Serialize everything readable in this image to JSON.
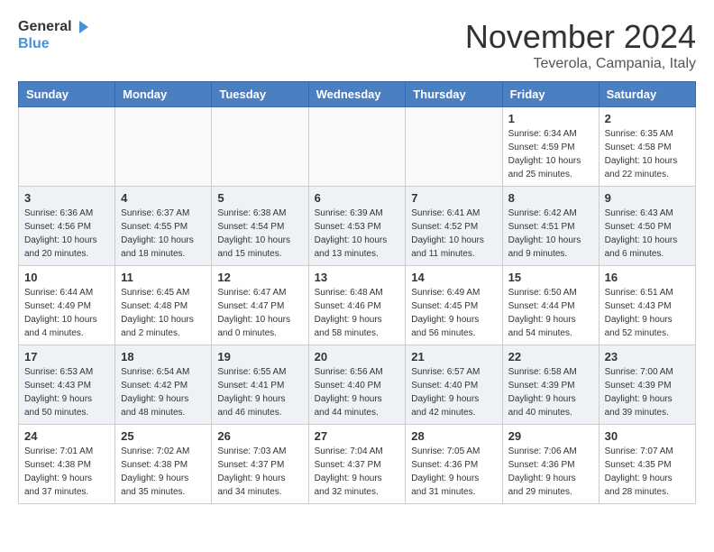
{
  "header": {
    "logo_line1": "General",
    "logo_line2": "Blue",
    "month": "November 2024",
    "location": "Teverola, Campania, Italy"
  },
  "weekdays": [
    "Sunday",
    "Monday",
    "Tuesday",
    "Wednesday",
    "Thursday",
    "Friday",
    "Saturday"
  ],
  "weeks": [
    [
      {
        "day": "",
        "info": ""
      },
      {
        "day": "",
        "info": ""
      },
      {
        "day": "",
        "info": ""
      },
      {
        "day": "",
        "info": ""
      },
      {
        "day": "",
        "info": ""
      },
      {
        "day": "1",
        "info": "Sunrise: 6:34 AM\nSunset: 4:59 PM\nDaylight: 10 hours\nand 25 minutes."
      },
      {
        "day": "2",
        "info": "Sunrise: 6:35 AM\nSunset: 4:58 PM\nDaylight: 10 hours\nand 22 minutes."
      }
    ],
    [
      {
        "day": "3",
        "info": "Sunrise: 6:36 AM\nSunset: 4:56 PM\nDaylight: 10 hours\nand 20 minutes."
      },
      {
        "day": "4",
        "info": "Sunrise: 6:37 AM\nSunset: 4:55 PM\nDaylight: 10 hours\nand 18 minutes."
      },
      {
        "day": "5",
        "info": "Sunrise: 6:38 AM\nSunset: 4:54 PM\nDaylight: 10 hours\nand 15 minutes."
      },
      {
        "day": "6",
        "info": "Sunrise: 6:39 AM\nSunset: 4:53 PM\nDaylight: 10 hours\nand 13 minutes."
      },
      {
        "day": "7",
        "info": "Sunrise: 6:41 AM\nSunset: 4:52 PM\nDaylight: 10 hours\nand 11 minutes."
      },
      {
        "day": "8",
        "info": "Sunrise: 6:42 AM\nSunset: 4:51 PM\nDaylight: 10 hours\nand 9 minutes."
      },
      {
        "day": "9",
        "info": "Sunrise: 6:43 AM\nSunset: 4:50 PM\nDaylight: 10 hours\nand 6 minutes."
      }
    ],
    [
      {
        "day": "10",
        "info": "Sunrise: 6:44 AM\nSunset: 4:49 PM\nDaylight: 10 hours\nand 4 minutes."
      },
      {
        "day": "11",
        "info": "Sunrise: 6:45 AM\nSunset: 4:48 PM\nDaylight: 10 hours\nand 2 minutes."
      },
      {
        "day": "12",
        "info": "Sunrise: 6:47 AM\nSunset: 4:47 PM\nDaylight: 10 hours\nand 0 minutes."
      },
      {
        "day": "13",
        "info": "Sunrise: 6:48 AM\nSunset: 4:46 PM\nDaylight: 9 hours\nand 58 minutes."
      },
      {
        "day": "14",
        "info": "Sunrise: 6:49 AM\nSunset: 4:45 PM\nDaylight: 9 hours\nand 56 minutes."
      },
      {
        "day": "15",
        "info": "Sunrise: 6:50 AM\nSunset: 4:44 PM\nDaylight: 9 hours\nand 54 minutes."
      },
      {
        "day": "16",
        "info": "Sunrise: 6:51 AM\nSunset: 4:43 PM\nDaylight: 9 hours\nand 52 minutes."
      }
    ],
    [
      {
        "day": "17",
        "info": "Sunrise: 6:53 AM\nSunset: 4:43 PM\nDaylight: 9 hours\nand 50 minutes."
      },
      {
        "day": "18",
        "info": "Sunrise: 6:54 AM\nSunset: 4:42 PM\nDaylight: 9 hours\nand 48 minutes."
      },
      {
        "day": "19",
        "info": "Sunrise: 6:55 AM\nSunset: 4:41 PM\nDaylight: 9 hours\nand 46 minutes."
      },
      {
        "day": "20",
        "info": "Sunrise: 6:56 AM\nSunset: 4:40 PM\nDaylight: 9 hours\nand 44 minutes."
      },
      {
        "day": "21",
        "info": "Sunrise: 6:57 AM\nSunset: 4:40 PM\nDaylight: 9 hours\nand 42 minutes."
      },
      {
        "day": "22",
        "info": "Sunrise: 6:58 AM\nSunset: 4:39 PM\nDaylight: 9 hours\nand 40 minutes."
      },
      {
        "day": "23",
        "info": "Sunrise: 7:00 AM\nSunset: 4:39 PM\nDaylight: 9 hours\nand 39 minutes."
      }
    ],
    [
      {
        "day": "24",
        "info": "Sunrise: 7:01 AM\nSunset: 4:38 PM\nDaylight: 9 hours\nand 37 minutes."
      },
      {
        "day": "25",
        "info": "Sunrise: 7:02 AM\nSunset: 4:38 PM\nDaylight: 9 hours\nand 35 minutes."
      },
      {
        "day": "26",
        "info": "Sunrise: 7:03 AM\nSunset: 4:37 PM\nDaylight: 9 hours\nand 34 minutes."
      },
      {
        "day": "27",
        "info": "Sunrise: 7:04 AM\nSunset: 4:37 PM\nDaylight: 9 hours\nand 32 minutes."
      },
      {
        "day": "28",
        "info": "Sunrise: 7:05 AM\nSunset: 4:36 PM\nDaylight: 9 hours\nand 31 minutes."
      },
      {
        "day": "29",
        "info": "Sunrise: 7:06 AM\nSunset: 4:36 PM\nDaylight: 9 hours\nand 29 minutes."
      },
      {
        "day": "30",
        "info": "Sunrise: 7:07 AM\nSunset: 4:35 PM\nDaylight: 9 hours\nand 28 minutes."
      }
    ]
  ]
}
